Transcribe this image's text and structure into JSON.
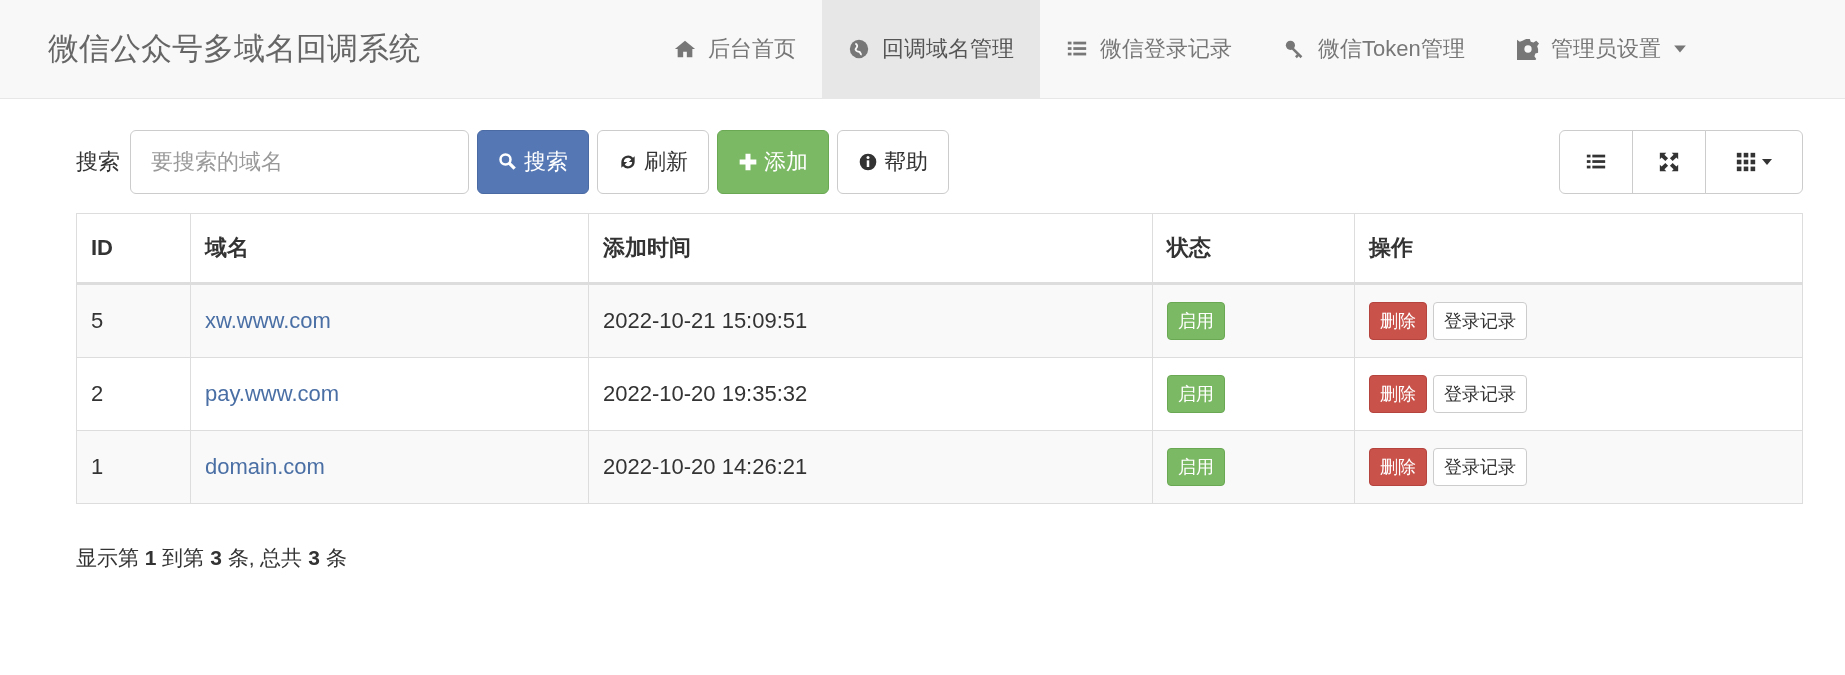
{
  "navbar": {
    "brand": "微信公众号多域名回调系统",
    "items": [
      {
        "label": "后台首页",
        "selected": false,
        "dropdown": false
      },
      {
        "label": "回调域名管理",
        "selected": true,
        "dropdown": false
      },
      {
        "label": "微信登录记录",
        "selected": false,
        "dropdown": false
      },
      {
        "label": "微信Token管理",
        "selected": false,
        "dropdown": false
      },
      {
        "label": "管理员设置",
        "selected": false,
        "dropdown": true
      }
    ]
  },
  "toolbar": {
    "search_label": "搜索",
    "search": {
      "placeholder": "要搜索的域名"
    },
    "buttons": [
      {
        "label": "搜索",
        "kind": "primary"
      },
      {
        "label": "刷新",
        "kind": "default"
      },
      {
        "label": "添加",
        "kind": "success"
      },
      {
        "label": "帮助",
        "kind": "default"
      }
    ]
  },
  "table": {
    "columns": [
      "ID",
      "域名",
      "添加时间",
      "状态",
      "操作"
    ],
    "rows": [
      {
        "id": "5",
        "domain": "xw.www.com",
        "added": "2022-10-21 15:09:51",
        "status": {
          "label": "启用",
          "enabled": true
        },
        "actions": [
          "删除",
          "登录记录"
        ]
      },
      {
        "id": "2",
        "domain": "pay.www.com",
        "added": "2022-10-20 19:35:32",
        "status": {
          "label": "启用",
          "enabled": true
        },
        "actions": [
          "删除",
          "登录记录"
        ]
      },
      {
        "id": "1",
        "domain": "domain.com",
        "added": "2022-10-20 14:26:21",
        "status": {
          "label": "启用",
          "enabled": true
        },
        "actions": [
          "删除",
          "登录记录"
        ]
      }
    ]
  },
  "pagination_info": "显示第 **1** 到第 **3** 条, 总共 **3** 条"
}
